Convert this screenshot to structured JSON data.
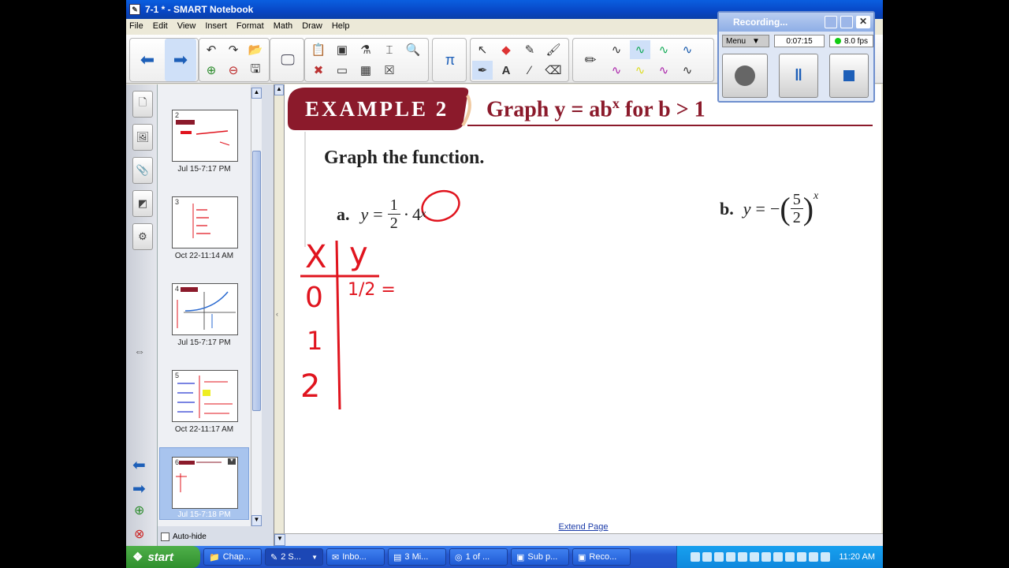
{
  "window": {
    "title": "7-1 * - SMART Notebook"
  },
  "menu": [
    "File",
    "Edit",
    "View",
    "Insert",
    "Format",
    "Math",
    "Draw",
    "Help"
  ],
  "slides": [
    {
      "num": "2",
      "label": "Jul 15-7:17 PM"
    },
    {
      "num": "3",
      "label": "Oct 22-11:14 AM"
    },
    {
      "num": "4",
      "label": "Jul 15-7:17 PM"
    },
    {
      "num": "5",
      "label": "Oct 22-11:17 AM"
    },
    {
      "num": "6",
      "label": "Jul 15-7:18 PM"
    }
  ],
  "autohide_label": "Auto-hide",
  "page": {
    "example_badge": "EXAMPLE 2",
    "example_title": "Graph y = ab",
    "example_exp": "x",
    "example_title_rest": " for b > 1",
    "instruction": "Graph the function.",
    "part_a_label": "a.",
    "part_b_label": "b.",
    "table_x": "X",
    "table_y": "y",
    "table_rows": [
      "0",
      "1",
      "2"
    ],
    "table_val": "1/2 ="
  },
  "extend_label": "Extend Page",
  "recording": {
    "title": "Recording...",
    "menu": "Menu",
    "time": "0:07:15",
    "fps": "8.0 fps"
  },
  "taskbar": {
    "start": "start",
    "tasks": [
      "Chap...",
      "2 S...",
      "Inbo...",
      "3 Mi...",
      "1 of ...",
      "Sub p...",
      "Reco..."
    ],
    "clock": "11:20 AM"
  },
  "colors": {
    "accent": "#8b1a2b",
    "ink": "#e0141e"
  }
}
